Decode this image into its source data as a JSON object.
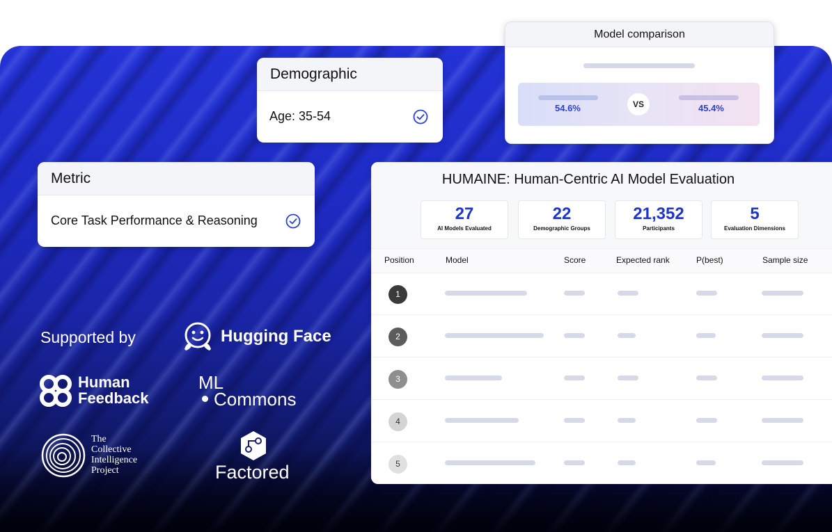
{
  "demographic": {
    "title": "Demographic",
    "value": "Age: 35-54"
  },
  "metric": {
    "title": "Metric",
    "value": "Core Task Performance & Reasoning"
  },
  "comparison": {
    "title": "Model comparison",
    "left_pct": "54.6%",
    "vs": "VS",
    "right_pct": "45.4%"
  },
  "board": {
    "title": "HUMAINE: Human-Centric AI Model Evaluation",
    "stats": [
      {
        "value": "27",
        "label": "AI Models Evaluated"
      },
      {
        "value": "22",
        "label": "Demographic Groups"
      },
      {
        "value": "21,352",
        "label": "Participants"
      },
      {
        "value": "5",
        "label": "Evaluation Dimensions"
      }
    ],
    "columns": [
      "Position",
      "Model",
      "Score",
      "Expected rank",
      "P(best)",
      "Sample size"
    ],
    "rows": [
      "1",
      "2",
      "3",
      "4",
      "5"
    ]
  },
  "supporters": {
    "label": "Supported by",
    "hugging_face": "Hugging Face",
    "human_feedback_1": "Human",
    "human_feedback_2": "Feedback",
    "ml_commons_1": "ML",
    "ml_commons_2": "Commons",
    "cip_1": "The",
    "cip_2": "Collective",
    "cip_3": "Intelligence",
    "cip_4": "Project",
    "factored": "Factored"
  },
  "colors": {
    "accent": "#1f35c9",
    "hero": "#1e2bc4"
  }
}
